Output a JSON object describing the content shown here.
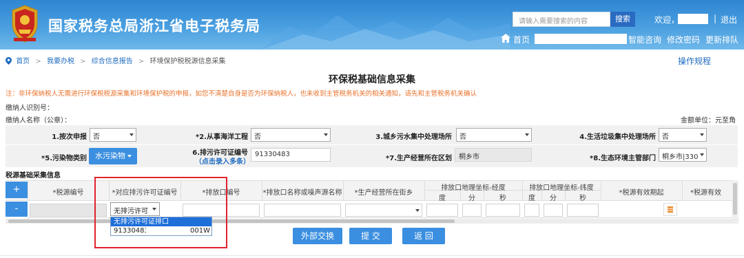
{
  "header": {
    "site_title": "国家税务总局浙江省电子税务局",
    "search_placeholder": "请输入需要搜索的内容",
    "search_button": "搜索",
    "welcome": "欢迎，",
    "separator": "|",
    "logout": "退出",
    "home": "首页",
    "links": [
      "智能咨询",
      "修改密码",
      "更新排队"
    ]
  },
  "breadcrumb": {
    "items": [
      "首页",
      "我要办税",
      "综合信息报告",
      "环境保护税税源信息采集"
    ],
    "separator": ">"
  },
  "operation_guide": "操作规程",
  "page": {
    "title": "环保税基础信息采集",
    "note": "注：非环保纳税人无需进行环保税税源采集和环境保护税的申报，如您不清楚自身是否为环保纳税人，也未收到主管税务机关的相关通知，请先和主管税务机关确认",
    "taxpayer_id_label": "缴纳人识别号：",
    "taxpayer_name_label": "缴纳人名称（公章）：",
    "amount_unit": "金额单位：元至角"
  },
  "form": {
    "f1_label": "1.按次申报",
    "f1_value": "否",
    "f2_label": "*2.从事海洋工程",
    "f2_value": "否",
    "f3_label": "3.城乡污水集中处理场所",
    "f3_value": "否",
    "f4_label": "4.生活垃圾集中处理场所",
    "f4_value": "否",
    "f5_label": "*5.污染物类别",
    "f5_value": "水污染物",
    "f6_label": "6.排污许可证编号",
    "f6_link": "（点击录入多条）",
    "f6_value": "91330483",
    "f7_label": "*7.生产经营所在区划",
    "f7_value": "桐乡市",
    "f8_label": "*8.生态环境主管部门",
    "f8_value": "桐乡市|330"
  },
  "table": {
    "section_title": "税源基础采集信息",
    "add_button": "+",
    "remove_button": "-",
    "headers": {
      "tax_source_no": "*税源编号",
      "permit_no": "*对应排污许可证编号",
      "outlet_no": "*排放口编号",
      "outlet_name": "*排放口名称或噪声源名称",
      "street": "*生产经营所在街乡",
      "lon_group": "排放口地理坐标-经度",
      "lat_group": "排放口地理坐标-纬度",
      "deg": "度",
      "min": "分",
      "sec": "秒",
      "valid_from": "*税源有效期起",
      "valid_to": "*税源有效"
    },
    "row_permit_selected": "无排污许可",
    "dropdown_options": [
      "无排污许可证排口",
      "91330483",
      "001W"
    ]
  },
  "actions": [
    "外部交换",
    "提 交",
    "返 回"
  ]
}
